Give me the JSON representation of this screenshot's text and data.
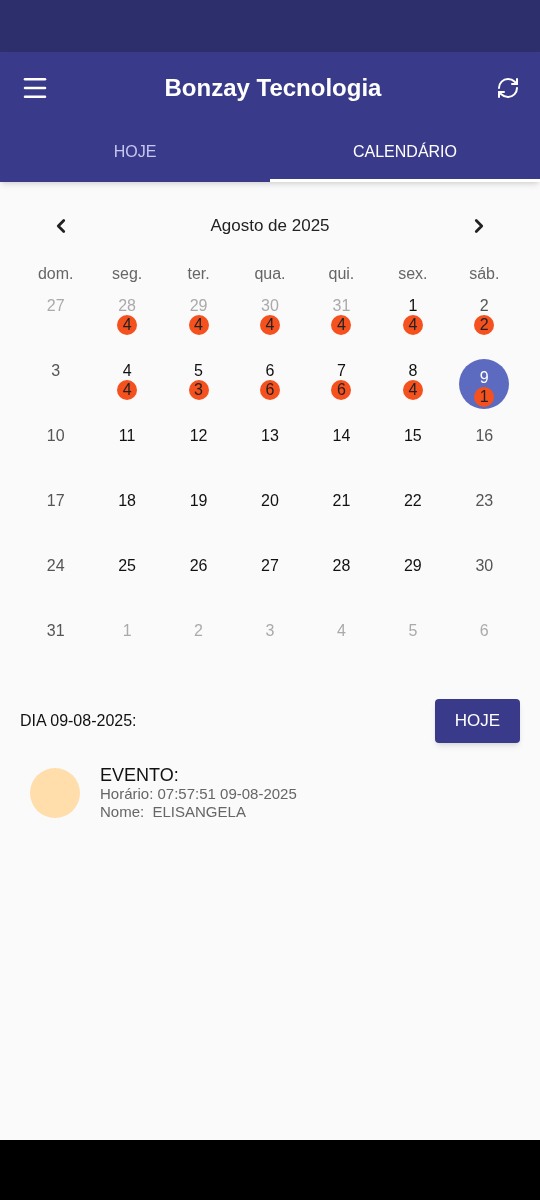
{
  "app_bar": {
    "title": "Bonzay Tecnologia"
  },
  "tabs": [
    {
      "label": "HOJE",
      "selected": false
    },
    {
      "label": "CALENDÁRIO",
      "selected": true
    }
  ],
  "calendar": {
    "month": "Agosto de 2025",
    "weekdays": [
      "dom.",
      "seg.",
      "ter.",
      "qua.",
      "qui.",
      "sex.",
      "sáb."
    ],
    "weeks": [
      [
        {
          "day": "27",
          "kind": "other",
          "selected": false
        },
        {
          "day": "28",
          "kind": "other",
          "selected": false,
          "count": "4"
        },
        {
          "day": "29",
          "kind": "other",
          "selected": false,
          "count": "4"
        },
        {
          "day": "30",
          "kind": "other",
          "selected": false,
          "count": "4"
        },
        {
          "day": "31",
          "kind": "other",
          "selected": false,
          "count": "4"
        },
        {
          "day": "1",
          "kind": "weekday",
          "selected": false,
          "count": "4"
        },
        {
          "day": "2",
          "kind": "weekend",
          "selected": false,
          "count": "2"
        }
      ],
      [
        {
          "day": "3",
          "kind": "weekend",
          "selected": false
        },
        {
          "day": "4",
          "kind": "weekday",
          "selected": false,
          "count": "4"
        },
        {
          "day": "5",
          "kind": "weekday",
          "selected": false,
          "count": "3"
        },
        {
          "day": "6",
          "kind": "weekday",
          "selected": false,
          "count": "6"
        },
        {
          "day": "7",
          "kind": "weekday",
          "selected": false,
          "count": "6"
        },
        {
          "day": "8",
          "kind": "weekday",
          "selected": false,
          "count": "4"
        },
        {
          "day": "9",
          "kind": "weekend",
          "selected": true,
          "count": "1"
        }
      ],
      [
        {
          "day": "10",
          "kind": "weekend",
          "selected": false
        },
        {
          "day": "11",
          "kind": "weekday",
          "selected": false
        },
        {
          "day": "12",
          "kind": "weekday",
          "selected": false
        },
        {
          "day": "13",
          "kind": "weekday",
          "selected": false
        },
        {
          "day": "14",
          "kind": "weekday",
          "selected": false
        },
        {
          "day": "15",
          "kind": "weekday",
          "selected": false
        },
        {
          "day": "16",
          "kind": "weekend",
          "selected": false
        }
      ],
      [
        {
          "day": "17",
          "kind": "weekend",
          "selected": false
        },
        {
          "day": "18",
          "kind": "weekday",
          "selected": false
        },
        {
          "day": "19",
          "kind": "weekday",
          "selected": false
        },
        {
          "day": "20",
          "kind": "weekday",
          "selected": false
        },
        {
          "day": "21",
          "kind": "weekday",
          "selected": false
        },
        {
          "day": "22",
          "kind": "weekday",
          "selected": false
        },
        {
          "day": "23",
          "kind": "weekend",
          "selected": false
        }
      ],
      [
        {
          "day": "24",
          "kind": "weekend",
          "selected": false
        },
        {
          "day": "25",
          "kind": "weekday",
          "selected": false
        },
        {
          "day": "26",
          "kind": "weekday",
          "selected": false
        },
        {
          "day": "27",
          "kind": "weekday",
          "selected": false
        },
        {
          "day": "28",
          "kind": "weekday",
          "selected": false
        },
        {
          "day": "29",
          "kind": "weekday",
          "selected": false
        },
        {
          "day": "30",
          "kind": "weekend",
          "selected": false
        }
      ],
      [
        {
          "day": "31",
          "kind": "weekend",
          "selected": false
        },
        {
          "day": "1",
          "kind": "other",
          "selected": false
        },
        {
          "day": "2",
          "kind": "other",
          "selected": false
        },
        {
          "day": "3",
          "kind": "other",
          "selected": false
        },
        {
          "day": "4",
          "kind": "other",
          "selected": false
        },
        {
          "day": "5",
          "kind": "other",
          "selected": false
        },
        {
          "day": "6",
          "kind": "other",
          "selected": false
        }
      ]
    ]
  },
  "day_header": {
    "label": "DIA 09-08-2025:",
    "button": "HOJE"
  },
  "events": [
    {
      "title": "EVENTO:",
      "time": "Horário: 07:57:51 09-08-2025",
      "name": "Nome:  ELISANGELA",
      "color": "#ffdeab"
    }
  ]
}
